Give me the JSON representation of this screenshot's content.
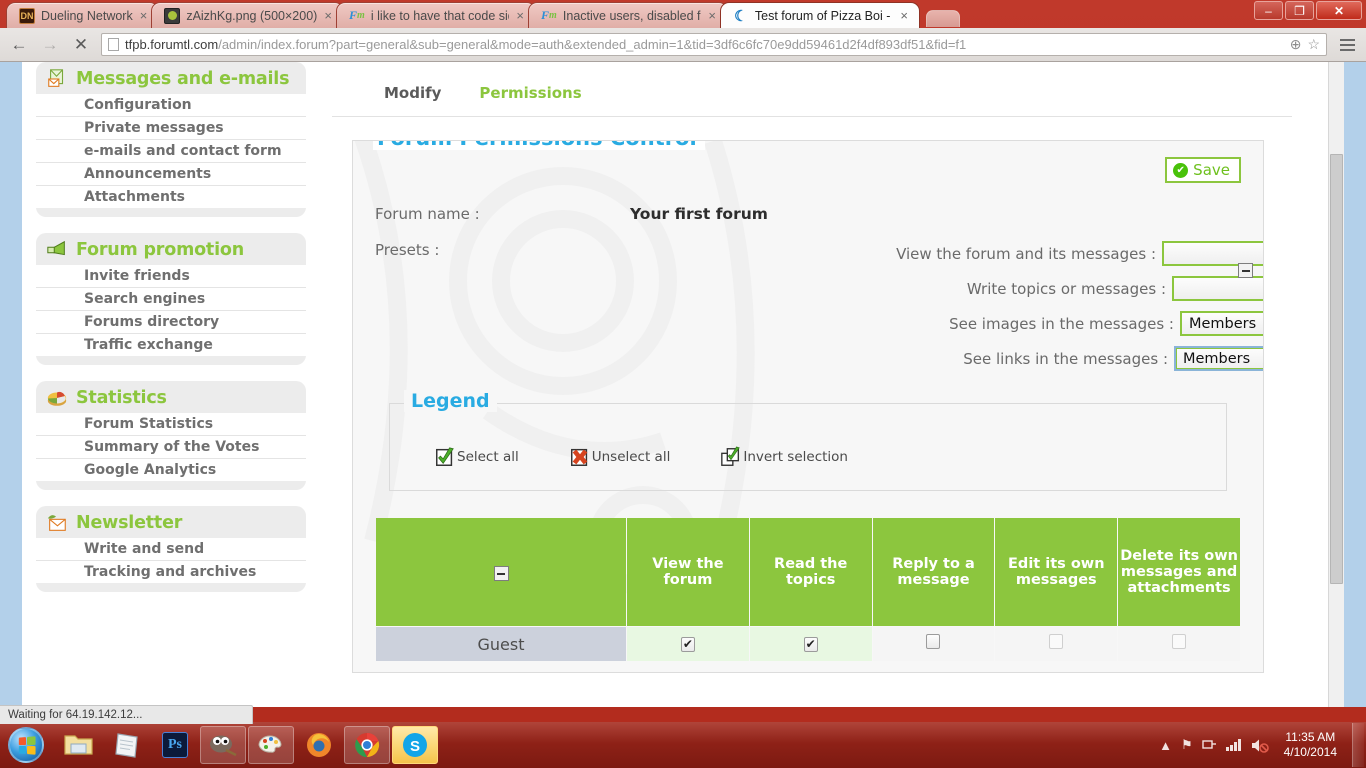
{
  "browser": {
    "tabs": [
      {
        "title": "Dueling Network",
        "favicon": "dueling-network-icon",
        "active": false,
        "close_label": "×"
      },
      {
        "title": "zAizhKg.png (500×200)",
        "favicon": "image-file-icon",
        "active": false,
        "close_label": "×"
      },
      {
        "title": "i like to have that code sid",
        "favicon": "forumotion-icon",
        "active": false,
        "close_label": "×"
      },
      {
        "title": "Inactive users, disabled fro",
        "favicon": "forumotion-icon",
        "active": false,
        "close_label": "×"
      },
      {
        "title": "Test forum of Pizza Boi - \\",
        "favicon": "moon-icon",
        "active": true,
        "close_label": "×"
      }
    ],
    "window_controls": {
      "minimize": "–",
      "restore": "❐",
      "close": "✕"
    },
    "nav": {
      "back": "←",
      "forward": "→",
      "stop": "✕"
    },
    "url_domain": "tfpb.forumtl.com",
    "url_path": "/admin/index.forum?part=general&sub=general&mode=auth&extended_admin=1&tid=3df6c6fc70e9dd59461d2f4df893df51&fid=f1",
    "omnibox_zoom_icon": "⊕",
    "omnibox_star_icon": "☆"
  },
  "sidebar": {
    "panels": [
      {
        "title": "Messages and e-mails",
        "icon": "mail-stack-icon",
        "links": [
          "Configuration",
          "Private messages",
          "e-mails and contact form",
          "Announcements",
          "Attachments"
        ]
      },
      {
        "title": "Forum promotion",
        "icon": "megaphone-icon",
        "links": [
          "Invite friends",
          "Search engines",
          "Forums directory",
          "Traffic exchange"
        ]
      },
      {
        "title": "Statistics",
        "icon": "pie-chart-icon",
        "links": [
          "Forum Statistics",
          "Summary of the Votes",
          "Google Analytics"
        ]
      },
      {
        "title": "Newsletter",
        "icon": "newsletter-envelope-icon",
        "links": [
          "Write and send",
          "Tracking and archives"
        ]
      }
    ]
  },
  "subnav": {
    "modify": "Modify",
    "permissions": "Permissions"
  },
  "main": {
    "card_title": "Forum Permissions Control",
    "save_label": "Save",
    "save_icon": "✔",
    "forum_name_label": "Forum name :",
    "forum_name_value": "Your first forum",
    "presets_label": "Presets :",
    "collapse_icon": "minus-box-icon",
    "presets": [
      {
        "label": "View the forum and its messages :",
        "value": "",
        "focused": false,
        "width": "w-lg"
      },
      {
        "label": "Write topics or messages :",
        "value": "",
        "focused": false,
        "width": "w-md"
      },
      {
        "label": "See images in the messages :",
        "value": "Members",
        "focused": false,
        "width": "w-sm"
      },
      {
        "label": "See links in the messages :",
        "value": "Members",
        "focused": true,
        "width": "w-xs"
      }
    ],
    "legend": {
      "title": "Legend",
      "items": [
        {
          "label": "Select all",
          "icon": "checkbox-checked-green-icon"
        },
        {
          "label": "Unselect all",
          "icon": "checkbox-x-red-icon"
        },
        {
          "label": "Invert selection",
          "icon": "checkbox-invert-icon"
        }
      ]
    },
    "table": {
      "first_col_header": "",
      "columns": [
        "View the forum",
        "Read the topics",
        "Reply to a message",
        "Edit its own messages",
        "Delete its own messages and attachments"
      ],
      "rows": [
        {
          "name": "Guest",
          "checks": [
            true,
            true,
            false,
            false,
            false
          ]
        }
      ],
      "check_glyph": "✔"
    }
  },
  "status_bar": {
    "text": "Waiting for 64.19.142.12..."
  },
  "taskbar": {
    "start_label": "start-orb",
    "items": [
      {
        "name": "file-explorer-icon",
        "state": "normal"
      },
      {
        "name": "notepad-icon",
        "state": "normal"
      },
      {
        "name": "photoshop-icon",
        "state": "normal",
        "label": "Ps"
      },
      {
        "name": "gimp-icon",
        "state": "pressed"
      },
      {
        "name": "paint-icon",
        "state": "pressed"
      },
      {
        "name": "firefox-icon",
        "state": "normal"
      },
      {
        "name": "chrome-icon",
        "state": "pressed"
      },
      {
        "name": "skype-icon",
        "state": "skype-active"
      }
    ],
    "tray": {
      "show_hidden": "▲",
      "action_center": "⚑",
      "network": "network-icon",
      "signal": "signal-bars-icon",
      "volume": "volume-muted-icon"
    },
    "time": "11:35 AM",
    "date": "4/10/2014"
  },
  "colors": {
    "accent_green": "#8cc63e",
    "title_blue": "#29abe2",
    "window_red": "#b32c1e",
    "page_blue": "#b3d0ea"
  }
}
